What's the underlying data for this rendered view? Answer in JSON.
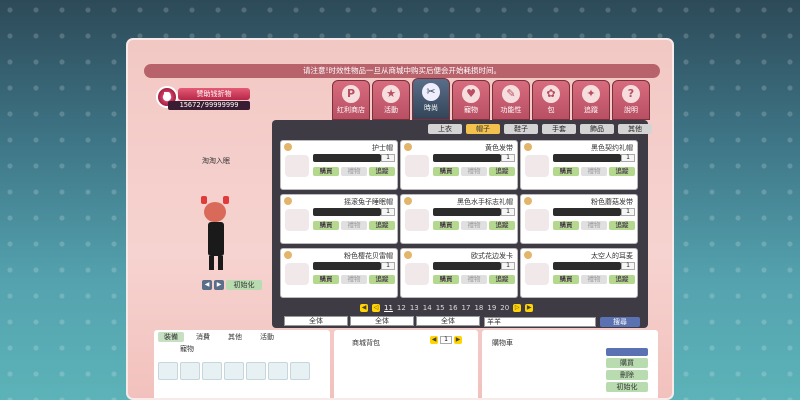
{
  "notice": "请注意!时效性物品一旦从商城中购买后便会开始耗损时间。",
  "gift": {
    "icon": "gift-icon",
    "button_label": "赞助钱折物",
    "count": "15672/99999999"
  },
  "tabs": [
    {
      "label": "红利商店",
      "icon": "P"
    },
    {
      "label": "活動",
      "icon": "★"
    },
    {
      "label": "時尚",
      "icon": "✂",
      "active": true
    },
    {
      "label": "寵物",
      "icon": "♥"
    },
    {
      "label": "功能性",
      "icon": "✎"
    },
    {
      "label": "包",
      "icon": "✿"
    },
    {
      "label": "追蹤",
      "icon": "✦"
    },
    {
      "label": "說明",
      "icon": "?"
    }
  ],
  "subtabs": [
    {
      "label": "上衣"
    },
    {
      "label": "帽子",
      "active": true
    },
    {
      "label": "鞋子"
    },
    {
      "label": "手套"
    },
    {
      "label": "飾品"
    },
    {
      "label": "其他"
    }
  ],
  "items": [
    {
      "name": "护士帽",
      "price": "1"
    },
    {
      "name": "黄色发带",
      "price": "1"
    },
    {
      "name": "黑色契约礼帽",
      "price": "1"
    },
    {
      "name": "摇滚兔子睡眠帽",
      "price": "1"
    },
    {
      "name": "黑色水手标志礼帽",
      "price": "1"
    },
    {
      "name": "粉色蘑菇发带",
      "price": "1"
    },
    {
      "name": "粉色樱花贝雷帽",
      "price": "1"
    },
    {
      "name": "欧式花边发卡",
      "price": "1"
    },
    {
      "name": "太空人的耳麦",
      "price": "1"
    }
  ],
  "item_buttons": {
    "buy": "購買",
    "gift": "禮物",
    "track": "追蹤"
  },
  "pager": {
    "pages": [
      "11",
      "12",
      "13",
      "14",
      "15",
      "16",
      "17",
      "18",
      "19",
      "20"
    ],
    "current": "11"
  },
  "filters": [
    "全体",
    "全体",
    "全体"
  ],
  "search": {
    "value": "羊羊",
    "button": "搜尋"
  },
  "character": {
    "name": "淘淘入眠",
    "reset_label": "初始化"
  },
  "bottom_left": {
    "tabs": [
      "裝備",
      "消費",
      "其他",
      "活動"
    ],
    "active_tab": "裝備",
    "sub_label": "寵物"
  },
  "bottom_mid": {
    "title": "商城背包",
    "page": "1",
    "badge": "07"
  },
  "bottom_right": {
    "title": "購物車",
    "buttons": [
      "購買",
      "刪除",
      "初始化"
    ]
  }
}
